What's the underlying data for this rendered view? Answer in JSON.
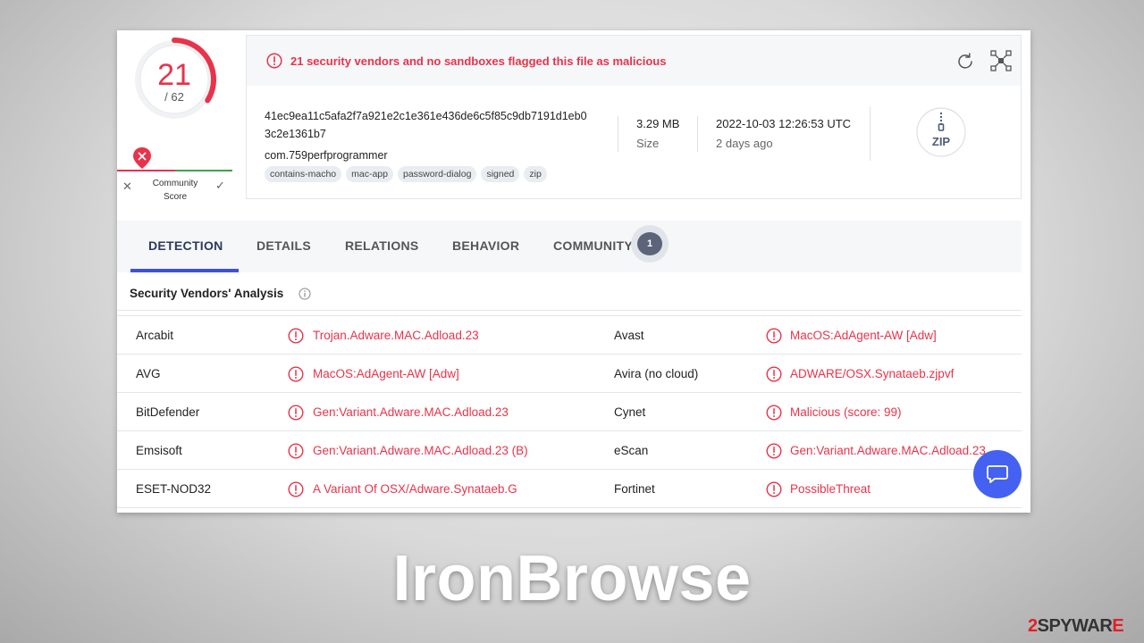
{
  "score": {
    "value": "21",
    "total": "/ 62",
    "fraction_flagged": 0.339
  },
  "community": {
    "label_line1": "Community",
    "label_line2": "Score"
  },
  "alert": {
    "text": "21 security vendors and no sandboxes flagged this file as malicious"
  },
  "file": {
    "hash_line1": "41ec9ea11c5afa2f7a921e2c1e361e436de6c5f85c9db7191d1eb0",
    "hash_line2": "3c2e1361b7",
    "name": "com.759perfprogrammer",
    "tags": [
      "contains-macho",
      "mac-app",
      "password-dialog",
      "signed",
      "zip"
    ],
    "size_value": "3.29 MB",
    "size_label": "Size",
    "date_value": "2022-10-03 12:26:53 UTC",
    "date_label": "2 days ago",
    "type_label": "ZIP"
  },
  "tabs": [
    {
      "label": "DETECTION"
    },
    {
      "label": "DETAILS"
    },
    {
      "label": "RELATIONS"
    },
    {
      "label": "BEHAVIOR"
    },
    {
      "label": "COMMUNITY"
    }
  ],
  "community_count": "1",
  "section_title": "Security Vendors' Analysis",
  "vendors": [
    {
      "left_name": "Arcabit",
      "left_result": "Trojan.Adware.MAC.Adload.23",
      "right_name": "Avast",
      "right_result": "MacOS:AdAgent-AW [Adw]"
    },
    {
      "left_name": "AVG",
      "left_result": "MacOS:AdAgent-AW [Adw]",
      "right_name": "Avira (no cloud)",
      "right_result": "ADWARE/OSX.Synataeb.zjpvf"
    },
    {
      "left_name": "BitDefender",
      "left_result": "Gen:Variant.Adware.MAC.Adload.23",
      "right_name": "Cynet",
      "right_result": "Malicious (score: 99)"
    },
    {
      "left_name": "Emsisoft",
      "left_result": "Gen:Variant.Adware.MAC.Adload.23 (B)",
      "right_name": "eScan",
      "right_result": "Gen:Variant.Adware.MAC.Adload.23"
    },
    {
      "left_name": "ESET-NOD32",
      "left_result": "A Variant Of OSX/Adware.Synataeb.G",
      "right_name": "Fortinet",
      "right_result": "PossibleThreat"
    }
  ],
  "overlay_title": "IronBrowse",
  "watermark": {
    "prefix": "2",
    "main": "SPYWAR",
    "accent": "E"
  },
  "colors": {
    "malicious": "#e8334a",
    "accent_blue": "#3f51d8",
    "chat": "#4461f2",
    "clean": "#3fa14a"
  },
  "icons": [
    "alert-circle-icon",
    "reload-icon",
    "graph-icon",
    "zip-file-icon",
    "info-icon",
    "chat-icon",
    "close-icon",
    "check-icon"
  ]
}
